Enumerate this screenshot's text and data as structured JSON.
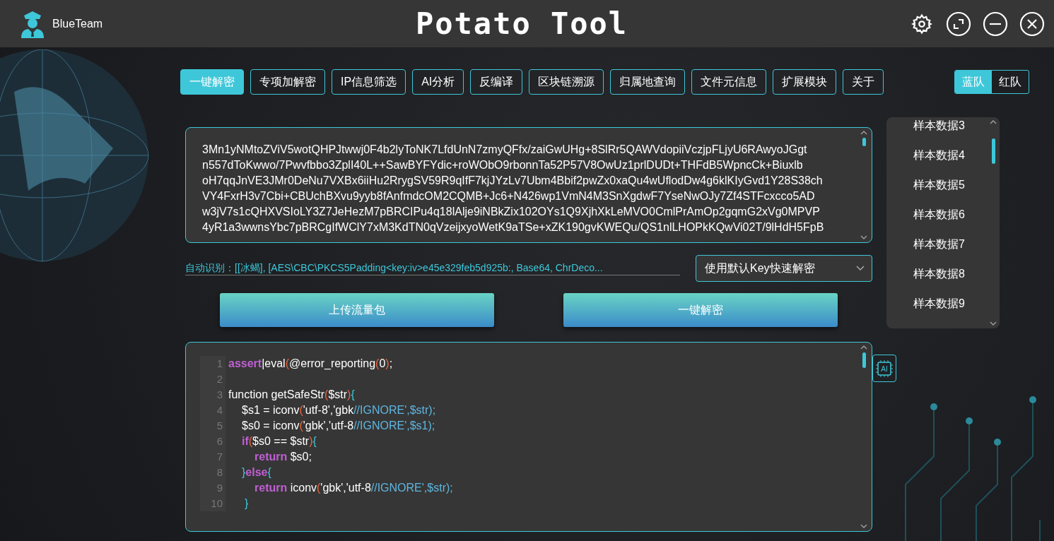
{
  "header": {
    "user": "BlueTeam",
    "title": "Potato Tool"
  },
  "tabs": [
    {
      "label": "一键解密",
      "selected": true
    },
    {
      "label": "专项加解密",
      "selected": false
    },
    {
      "label": "IP信息筛选",
      "selected": false
    },
    {
      "label": "AI分析",
      "selected": false
    },
    {
      "label": "反编译",
      "selected": false
    },
    {
      "label": "区块链溯源",
      "selected": false
    },
    {
      "label": "归属地查询",
      "selected": false
    },
    {
      "label": "文件元信息",
      "selected": false
    },
    {
      "label": "扩展模块",
      "selected": false
    },
    {
      "label": "关于",
      "selected": false
    }
  ],
  "team_toggle": [
    {
      "label": "蓝队",
      "selected": true
    },
    {
      "label": "红队",
      "selected": false
    }
  ],
  "input_text": [
    "3Mn1yNMtoZViV5wotQHPJtwwj0F4b2lyToNK7LfdUnN7zmyQFfx/zaiGwUHg+8SlRr5QAWVdopiiVczjpFLjyU6RAwyoJGgt",
    "n557dToKwwo/7Pwvfbbo3ZplI40L++SawBYFYdic+roWObO9rbonnTa52P57V8OwUz1prlDUDt+THFdB5WpncCk+Biuxlb",
    "oH7qqJnVE3JMr0DeNu7VXBx6iiHu2RrygSV59R9qIfF7kjJYzLv7Ubm4Bbif2pwZx0xaQu4wUflodDw4g6klKIyGvd1Y28S38ch",
    "VY4FxrH3v7Cbi+CBUchBXvu9yyb8fAnfmdcOM2CQMB+Jc6+N426wp1VmN4M3SnXgdwF7YseNwOJy7Zf4STFcxcco5AD",
    "w3jV7s1cQHXVSIoLY3Z7JeHezM7pBRCIPu4q18lAlje9iNBkZix102OYs1Q9XjhXkLeMVO0CmlPrAmOp2gqmG2xVg0MPVP",
    "4yR1a3wwnsYbc7pBRCgIfWClY7xM3KdTN0qVzeijxyoWetK9aTSe+xZK190gvKWEQu/QS1nlLHOPkKQwVi02T/9lHdH5FpB"
  ],
  "auto_detect": "自动识别：[[冰蝎], [AES\\CBC\\PKCS5Padding<key:iv>e45e329feb5d925b:, Base64, ChrDeco...",
  "key_mode": {
    "value": "使用默认Key快速解密"
  },
  "actions": [
    "上传流量包",
    "一键解密"
  ],
  "samples": [
    "样本数据3",
    "样本数据4",
    "样本数据5",
    "样本数据6",
    "样本数据7",
    "样本数据8",
    "样本数据9"
  ],
  "ai_badge": "AI",
  "code": [
    {
      "number": "1",
      "kind": "top",
      "tokens": [
        {
          "text": "assert",
          "kind": "keyword"
        },
        {
          "text": "|eval",
          "kind": "plain"
        },
        {
          "text": "(",
          "kind": "paren"
        },
        {
          "text": "@error_reporting",
          "kind": "plain"
        },
        {
          "text": "(",
          "kind": "paren"
        },
        {
          "text": "0",
          "kind": "plain"
        },
        {
          "text": ")",
          "kind": "paren"
        },
        {
          "text": ";",
          "kind": "plain"
        }
      ]
    },
    {
      "number": "2"
    },
    {
      "number": "3",
      "kind": "top",
      "tokens": [
        {
          "text": "function getSafeStr",
          "kind": "plain"
        },
        {
          "text": "(",
          "kind": "paren"
        },
        {
          "text": "$str",
          "kind": "plain"
        },
        {
          "text": ")",
          "kind": "paren"
        },
        {
          "text": "{",
          "kind": "brace"
        }
      ]
    },
    {
      "number": "4",
      "kind": "inner",
      "tokens": [
        {
          "text": "$s1 = iconv",
          "kind": "plain"
        },
        {
          "text": "(",
          "kind": "paren"
        },
        {
          "text": "'utf-8','gbk",
          "kind": "plain"
        },
        {
          "text": "//IGNORE',$str);",
          "kind": "comment"
        }
      ]
    },
    {
      "number": "5",
      "kind": "inner",
      "tokens": [
        {
          "text": "$s0 = iconv",
          "kind": "plain"
        },
        {
          "text": "(",
          "kind": "paren"
        },
        {
          "text": "'gbk','utf-8",
          "kind": "plain"
        },
        {
          "text": "//IGNORE',$s1);",
          "kind": "comment"
        }
      ]
    },
    {
      "number": "6",
      "kind": "inner",
      "tokens": [
        {
          "text": "if",
          "kind": "keyword"
        },
        {
          "text": "(",
          "kind": "paren"
        },
        {
          "text": "$s0 == $str",
          "kind": "plain"
        },
        {
          "text": ")",
          "kind": "paren"
        },
        {
          "text": "{",
          "kind": "brace"
        }
      ]
    },
    {
      "number": "7",
      "kind": "inner2",
      "tokens": [
        {
          "text": "return",
          "kind": "keyword"
        },
        {
          "text": " $s0;",
          "kind": "plain"
        }
      ]
    },
    {
      "number": "8",
      "kind": "inner",
      "tokens": [
        {
          "text": "}",
          "kind": "brace"
        },
        {
          "text": "else",
          "kind": "keyword"
        },
        {
          "text": "{",
          "kind": "brace"
        }
      ]
    },
    {
      "number": "9",
      "kind": "inner2",
      "tokens": [
        {
          "text": "return",
          "kind": "keyword"
        },
        {
          "text": " iconv",
          "kind": "plain"
        },
        {
          "text": "(",
          "kind": "paren"
        },
        {
          "text": "'gbk','utf-8",
          "kind": "plain"
        },
        {
          "text": "//IGNORE',$str);",
          "kind": "comment"
        }
      ]
    },
    {
      "number": "10",
      "kind": "close",
      "tokens": [
        {
          "text": "}",
          "kind": "brace"
        }
      ]
    }
  ]
}
